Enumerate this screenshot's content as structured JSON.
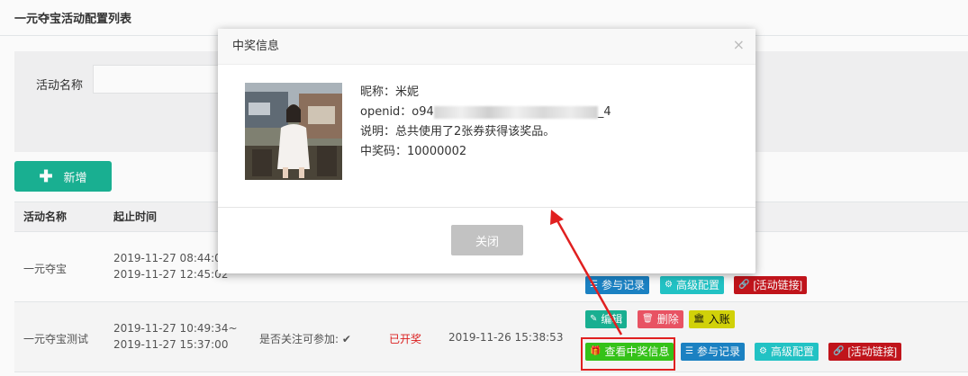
{
  "page": {
    "title": "一元夺宝活动配置列表"
  },
  "search": {
    "label": "活动名称",
    "placeholder": ""
  },
  "toolbar": {
    "add_label": "新增"
  },
  "table": {
    "headers": [
      "活动名称",
      "起止时间"
    ],
    "rows": [
      {
        "name": "一元夺宝",
        "start": "2019-11-27 08:44:02~",
        "end": "2019-11-27 12:45:02",
        "actions": [
          "参与记录",
          "高级配置",
          "[活动链接]"
        ]
      },
      {
        "name": "一元夺宝测试",
        "start": "2019-11-27 10:49:34~",
        "end": "2019-11-27 15:37:00",
        "follow": "是否关注可参加: ✔",
        "status": "已开奖",
        "draw_time": "2019-11-26 15:38:53",
        "actions_top": [
          "编辑",
          "删除",
          "入账"
        ],
        "actions_bottom": [
          "查看中奖信息",
          "参与记录",
          "高级配置",
          "[活动链接]"
        ]
      }
    ]
  },
  "modal": {
    "title": "中奖信息",
    "close_icon": "×",
    "nickname": "昵称：米妮",
    "openid_prefix": "openid：o94",
    "openid_suffix": "_4",
    "desc": "说明：总共使用了2张券获得该奖品。",
    "code": "中奖码：10000002",
    "close_label": "关闭"
  },
  "colors": {
    "primary": "#1ab394",
    "blue": "#1c84c6",
    "teal": "#23c6c8",
    "darkred": "#c4151c",
    "danger": "#ed5565",
    "annotation": "#e02020"
  }
}
